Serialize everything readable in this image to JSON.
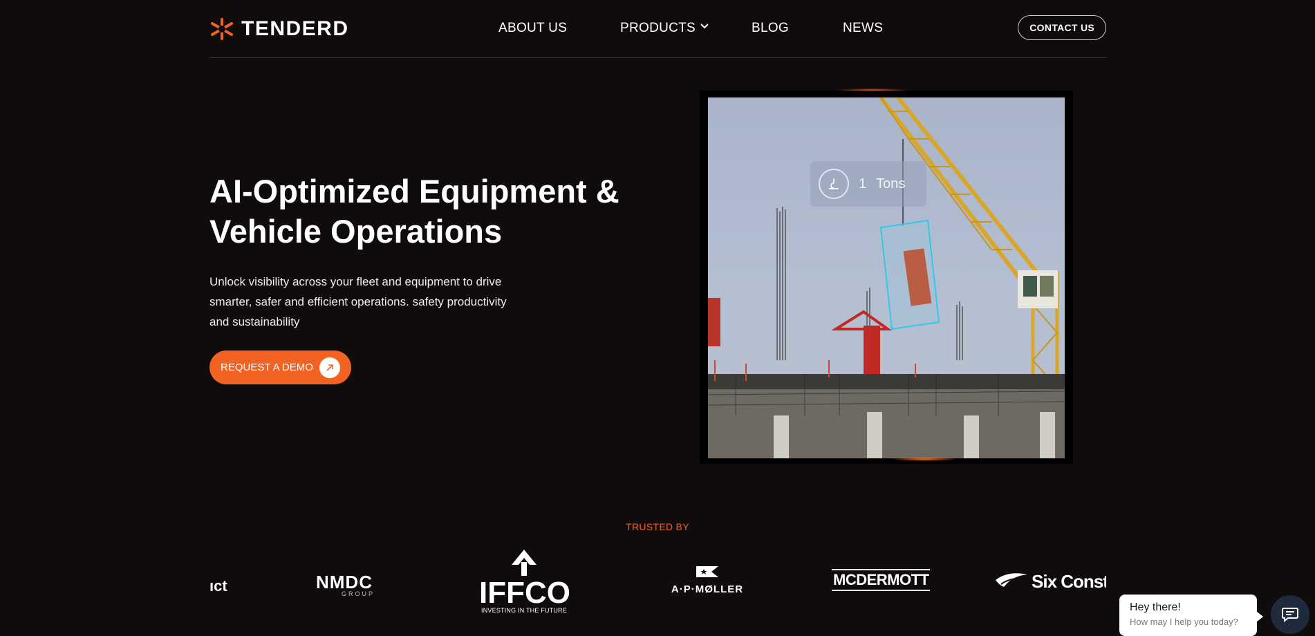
{
  "header": {
    "brand": "TENDERD",
    "nav": [
      "ABOUT US",
      "PRODUCTS",
      "BLOG",
      "NEWS"
    ],
    "contact": "CONTACT US"
  },
  "hero": {
    "title_line1": "AI-Optimized Equipment &",
    "title_line2": "Vehicle Operations",
    "subtitle": "Unlock visibility across your fleet and equipment to drive smarter, safer and efficient operations. safety productivity and sustainability",
    "cta": "REQUEST A DEMO"
  },
  "video_overlay": {
    "value": "1",
    "unit": "Tons"
  },
  "trusted": {
    "label": "TRUSTED BY",
    "logos": {
      "partial_left": "ıct",
      "nmdc": "NMDC",
      "nmdc_sub": "GROUP",
      "iffco": "IFFCO",
      "iffco_sub": "INVESTING IN THE FUTURE",
      "moller": "A·P·MØLLER",
      "mcdermott": "MCDERMOTT",
      "six": "Six Constru"
    }
  },
  "chat": {
    "title": "Hey there!",
    "subtitle": "How may I help you today?"
  },
  "colors": {
    "background": "#110c0c",
    "accent": "#f26222"
  }
}
